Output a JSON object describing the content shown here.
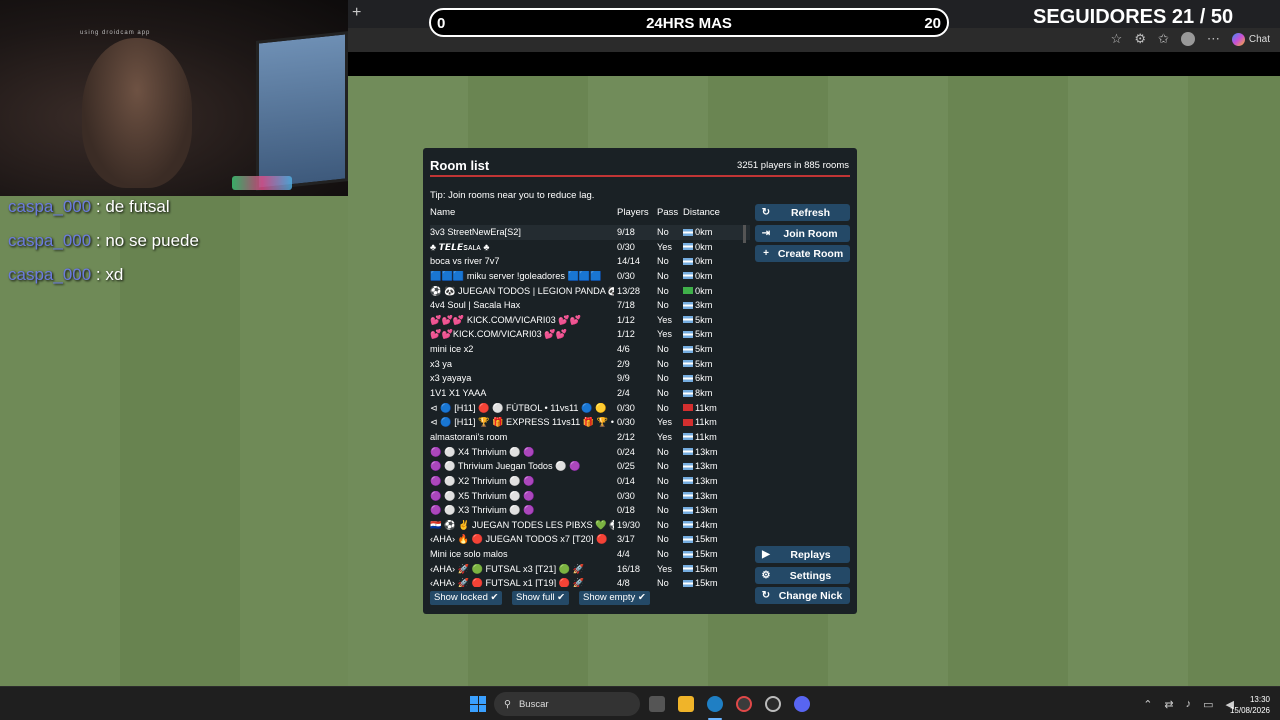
{
  "stream": {
    "goal_left": "0",
    "goal_title": "24HRS MAS",
    "goal_right": "20",
    "followers": "SEGUIDORES 21 / 50",
    "cam_watermark": "using droidcam app"
  },
  "browser": {
    "chat_label": "Chat"
  },
  "chat": [
    {
      "user": "caspa_000",
      "message": " : de futsal"
    },
    {
      "user": "caspa_000",
      "message": " : no se puede"
    },
    {
      "user": "caspa_000",
      "message": " : xd"
    }
  ],
  "room_list": {
    "title": "Room list",
    "count": "3251 players in 885 rooms",
    "tip": "Tip: Join rooms near you to reduce lag.",
    "columns": {
      "name": "Name",
      "players": "Players",
      "pass": "Pass",
      "distance": "Distance"
    },
    "rows": [
      {
        "name": "3v3 StreetNewEra[S2]",
        "players": "9/18",
        "pass": "No",
        "distance": "0km",
        "flag": "ar"
      },
      {
        "name": "♣ 𝙏𝙀𝙇𝙀ꜱᴀʟᴀ ♣",
        "players": "0/30",
        "pass": "Yes",
        "distance": "0km",
        "flag": "ar"
      },
      {
        "name": "boca vs river 7v7",
        "players": "14/14",
        "pass": "No",
        "distance": "0km",
        "flag": "ar"
      },
      {
        "name": "🟦🟦🟦 miku server !goleadores 🟦🟦🟦",
        "players": "0/30",
        "pass": "No",
        "distance": "0km",
        "flag": "ar"
      },
      {
        "name": "⚽ 🐼 JUEGAN TODOS | LEGION PANDA 🐼",
        "players": "13/28",
        "pass": "No",
        "distance": "0km",
        "flag": "green"
      },
      {
        "name": "4v4 Soul | Sacala Hax",
        "players": "7/18",
        "pass": "No",
        "distance": "3km",
        "flag": "ar"
      },
      {
        "name": "💕💕💕 KICK.COM/VICARI03 💕💕",
        "players": "1/12",
        "pass": "Yes",
        "distance": "5km",
        "flag": "ar"
      },
      {
        "name": "💕💕KICK.COM/VICARI03 💕💕",
        "players": "1/12",
        "pass": "Yes",
        "distance": "5km",
        "flag": "ar"
      },
      {
        "name": "mini ice x2",
        "players": "4/6",
        "pass": "No",
        "distance": "5km",
        "flag": "ar"
      },
      {
        "name": "x3 ya",
        "players": "2/9",
        "pass": "No",
        "distance": "5km",
        "flag": "ar"
      },
      {
        "name": "x3 yayaya",
        "players": "9/9",
        "pass": "No",
        "distance": "6km",
        "flag": "ar"
      },
      {
        "name": "1V1 X1 YAAA",
        "players": "2/4",
        "pass": "No",
        "distance": "8km",
        "flag": "ar"
      },
      {
        "name": "⊲ 🔵 [H11] 🔴 ⚪ FÚTBOL • 11vs11 🔵 🟡",
        "players": "0/30",
        "pass": "No",
        "distance": "11km",
        "flag": "red"
      },
      {
        "name": "⊲ 🔵 [H11] 🏆 🎁 EXPRESS 11vs11 🎁 🏆 •",
        "players": "0/30",
        "pass": "Yes",
        "distance": "11km",
        "flag": "red"
      },
      {
        "name": "almastorani's room",
        "players": "2/12",
        "pass": "Yes",
        "distance": "11km",
        "flag": "ar"
      },
      {
        "name": "🟣 ⚪ X4 Thrivium ⚪ 🟣",
        "players": "0/24",
        "pass": "No",
        "distance": "13km",
        "flag": "ar"
      },
      {
        "name": "🟣 ⚪ Thrivium Juegan Todos ⚪ 🟣",
        "players": "0/25",
        "pass": "No",
        "distance": "13km",
        "flag": "ar"
      },
      {
        "name": "🟣 ⚪ X2 Thrivium ⚪ 🟣",
        "players": "0/14",
        "pass": "No",
        "distance": "13km",
        "flag": "ar"
      },
      {
        "name": "🟣 ⚪ X5 Thrivium ⚪ 🟣",
        "players": "0/30",
        "pass": "No",
        "distance": "13km",
        "flag": "ar"
      },
      {
        "name": "🟣 ⚪ X3 Thrivium ⚪ 🟣",
        "players": "0/18",
        "pass": "No",
        "distance": "13km",
        "flag": "ar"
      },
      {
        "name": "🇵🇾 ⚽ ✌ JUEGAN TODES LES PIBXS 💚 ⚽",
        "players": "19/30",
        "pass": "No",
        "distance": "14km",
        "flag": "ar"
      },
      {
        "name": "‹AHA› 🔥 🔴 JUEGAN TODOS x7 [T20] 🔴",
        "players": "3/17",
        "pass": "No",
        "distance": "15km",
        "flag": "ar"
      },
      {
        "name": "Mini ice solo malos",
        "players": "4/4",
        "pass": "No",
        "distance": "15km",
        "flag": "ar"
      },
      {
        "name": "‹AHA› 🚀 🟢 FUTSAL x3 [T21] 🟢 🚀",
        "players": "16/18",
        "pass": "Yes",
        "distance": "15km",
        "flag": "ar"
      },
      {
        "name": "‹AHA› 🚀 🔴 FUTSAL x1 [T19] 🔴 🚀",
        "players": "4/8",
        "pass": "No",
        "distance": "15km",
        "flag": "ar"
      }
    ],
    "buttons": {
      "refresh": "Refresh",
      "join": "Join Room",
      "create": "Create Room",
      "replays": "Replays",
      "settings": "Settings",
      "change_nick": "Change Nick"
    },
    "toggles": {
      "locked": "Show locked ✔",
      "full": "Show full ✔",
      "empty": "Show empty ✔"
    }
  },
  "taskbar": {
    "search_placeholder": "Buscar",
    "time": "13:30",
    "date": "15/08/2026"
  }
}
